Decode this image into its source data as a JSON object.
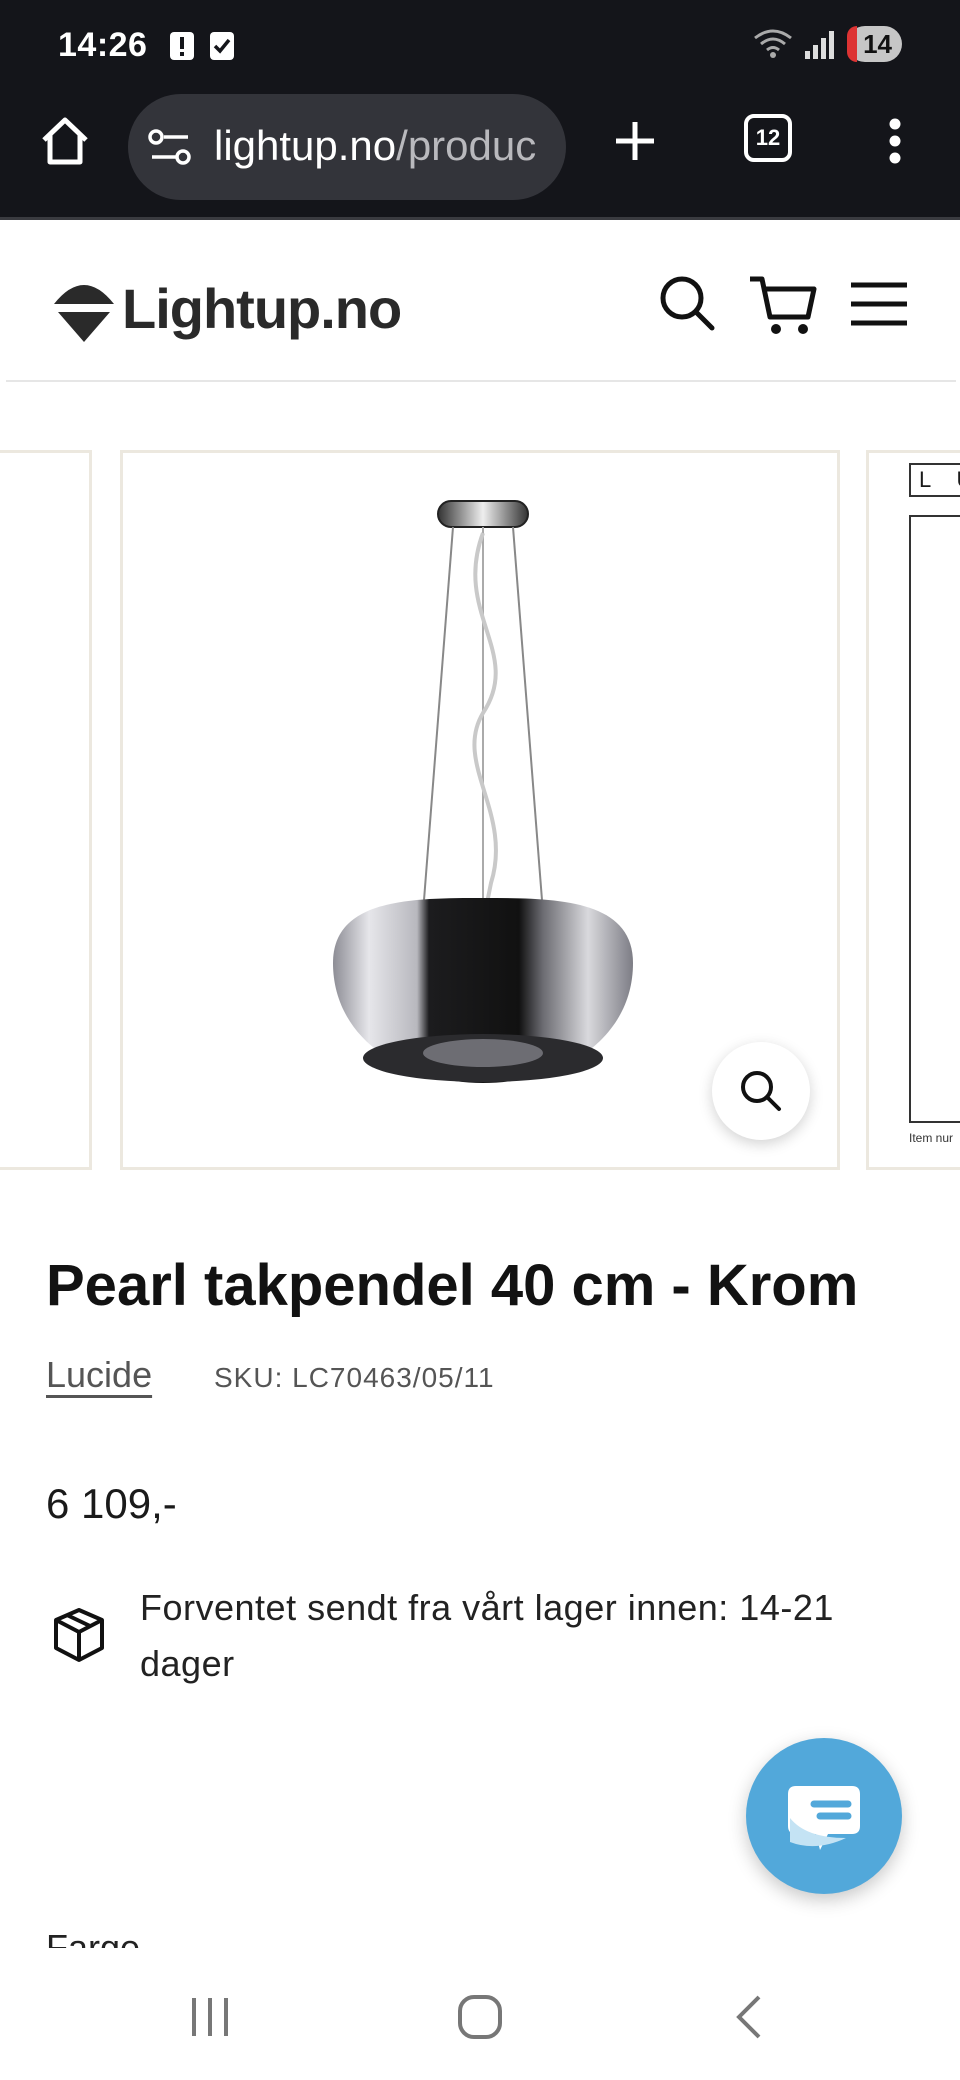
{
  "status_bar": {
    "time": "14:26",
    "battery": "14"
  },
  "browser": {
    "url_host": "lightup.no",
    "url_path": "/produc",
    "tabs_count": "12"
  },
  "site": {
    "logo_text": "Lightup.no"
  },
  "gallery": {
    "next_slide_label": "L U",
    "next_slide_caption": "Item nur"
  },
  "product": {
    "title": "Pearl takpendel 40 cm - Krom",
    "brand": "Lucide",
    "sku": "SKU: LC70463/05/11",
    "price": "6 109,-",
    "delivery": "Forventet sendt fra vårt lager innen: 14-21 dager",
    "color_label": "Farge"
  },
  "colors": {
    "chrome_bg": "#14151a",
    "url_pill": "#33343a",
    "chat_accent": "#52a8da",
    "slide_border": "#ece8df"
  }
}
